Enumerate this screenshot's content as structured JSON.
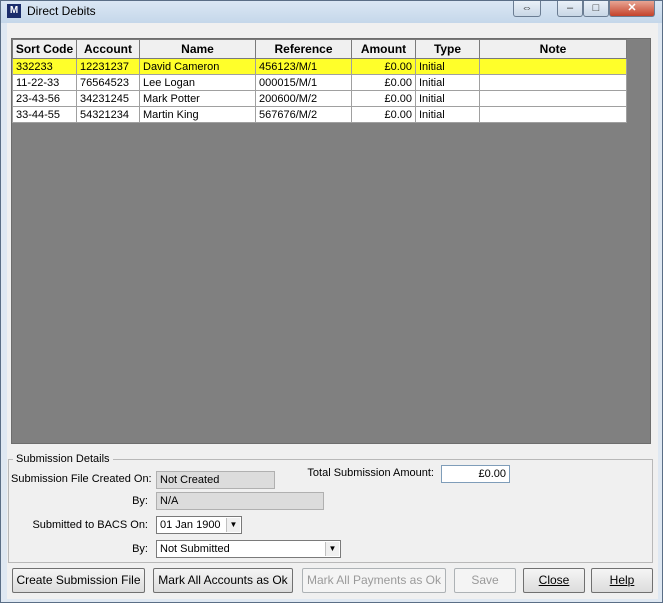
{
  "window": {
    "app_icon_text": "M",
    "title": "Direct Debits",
    "controls": {
      "resize": "⇔",
      "minimize": "–",
      "maximize": "□",
      "close": "✕"
    }
  },
  "grid": {
    "columns": [
      "Sort Code",
      "Account",
      "Name",
      "Reference",
      "Amount",
      "Type",
      "Note"
    ],
    "rows": [
      {
        "sort_code": "332233",
        "account": "12231237",
        "name": "David Cameron",
        "reference": "456123/M/1",
        "amount": "£0.00",
        "type": "Initial",
        "note": ""
      },
      {
        "sort_code": "11-22-33",
        "account": "76564523",
        "name": "Lee Logan",
        "reference": "000015/M/1",
        "amount": "£0.00",
        "type": "Initial",
        "note": ""
      },
      {
        "sort_code": "23-43-56",
        "account": "34231245",
        "name": "Mark Potter",
        "reference": "200600/M/2",
        "amount": "£0.00",
        "type": "Initial",
        "note": ""
      },
      {
        "sort_code": "33-44-55",
        "account": "54321234",
        "name": "Martin King",
        "reference": "567676/M/2",
        "amount": "£0.00",
        "type": "Initial",
        "note": ""
      }
    ]
  },
  "submission": {
    "legend": "Submission Details",
    "file_created_label": "Submission File Created On:",
    "file_created_value": "Not Created",
    "by_label": "By:",
    "by_value": "N/A",
    "total_label": "Total Submission Amount:",
    "total_value": "£0.00",
    "bacs_label": "Submitted to BACS On:",
    "bacs_value": "01 Jan 1900",
    "submitted_by_label": "By:",
    "submitted_by_value": "Not Submitted"
  },
  "buttons": {
    "create_file": "Create Submission File",
    "mark_accounts": "Mark All Accounts as Ok",
    "mark_payments": "Mark All Payments as Ok",
    "save": "Save",
    "close": "Close",
    "help": "Help"
  },
  "colors": {
    "selected_row": "#ffff2a",
    "grid_background": "#808080"
  }
}
